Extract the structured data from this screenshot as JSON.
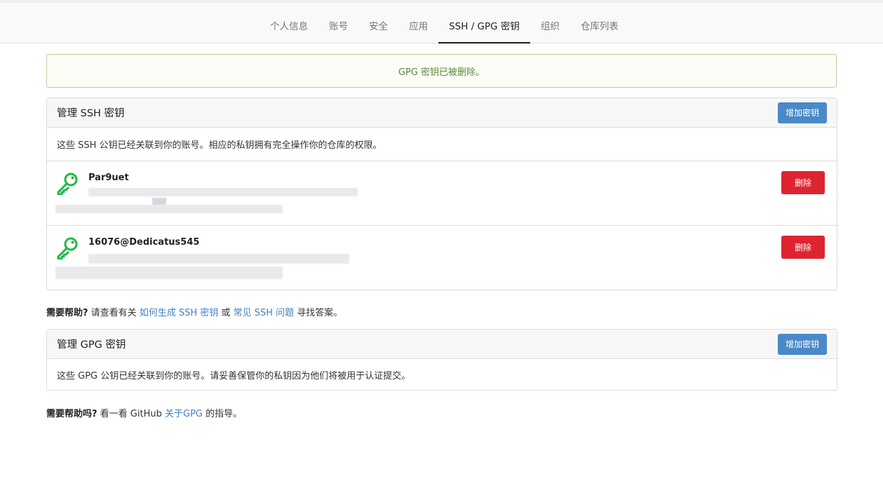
{
  "tabs": [
    {
      "label": "个人信息",
      "active": false
    },
    {
      "label": "账号",
      "active": false
    },
    {
      "label": "安全",
      "active": false
    },
    {
      "label": "应用",
      "active": false
    },
    {
      "label": "SSH / GPG 密钥",
      "active": true
    },
    {
      "label": "组织",
      "active": false
    },
    {
      "label": "仓库列表",
      "active": false
    }
  ],
  "flash_message": "GPG 密钥已被删除。",
  "ssh": {
    "title": "管理 SSH 密钥",
    "add_button": "增加密钥",
    "description": "这些 SSH 公钥已经关联到你的账号。相应的私钥拥有完全操作你的仓库的权限。",
    "keys": [
      {
        "name": "Par9uet",
        "delete_label": "删除"
      },
      {
        "name": "16076@Dedicatus545",
        "delete_label": "删除"
      }
    ]
  },
  "ssh_help": {
    "prefix_bold": "需要帮助?",
    "text1": " 请查看有关 ",
    "link1": "如何生成 SSH 密钥",
    "text2": " 或 ",
    "link2": "常见 SSH 问题",
    "text3": " 寻找答案。"
  },
  "gpg": {
    "title": "管理 GPG 密钥",
    "add_button": "增加密钥",
    "description": "这些 GPG 公钥已经关联到你的账号。请妥善保管你的私钥因为他们将被用于认证提交。"
  },
  "gpg_help": {
    "prefix_bold": "需要帮助吗?",
    "text1": " 看一看 GitHub ",
    "link1": "关于GPG",
    "text2": " 的指导。"
  },
  "colors": {
    "key_icon": "#21ba45",
    "add_button": "#4a89c8",
    "delete_button": "#dc2530",
    "link": "#4183c4",
    "success_text": "#5c8a3c"
  }
}
